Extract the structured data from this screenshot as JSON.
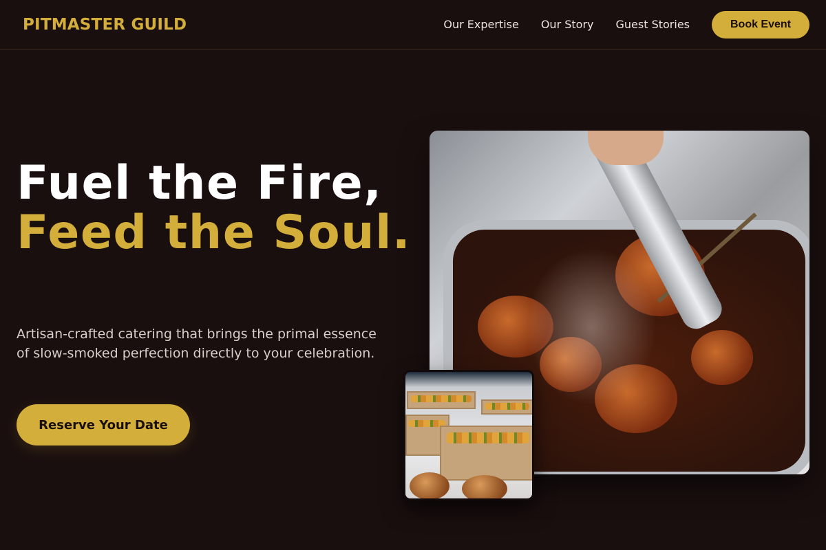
{
  "brand": {
    "logo_text": "PITMASTER GUILD",
    "accent": "#d4ae3a",
    "background": "#1a0f0f"
  },
  "nav": {
    "items": [
      {
        "label": "Our Expertise"
      },
      {
        "label": "Our Story"
      },
      {
        "label": "Guest Stories"
      }
    ],
    "cta_label": "Book Event"
  },
  "hero": {
    "title_line1": "Fuel the Fire,",
    "title_line2": "Feed the Soul.",
    "subtitle": "Artisan-crafted catering that brings the primal essence of slow-smoked perfection directly to your celebration.",
    "cta_label": "Reserve Your Date"
  },
  "images": {
    "main": "grilled-meat-tray-photo",
    "secondary": "catering-boxes-photo"
  }
}
